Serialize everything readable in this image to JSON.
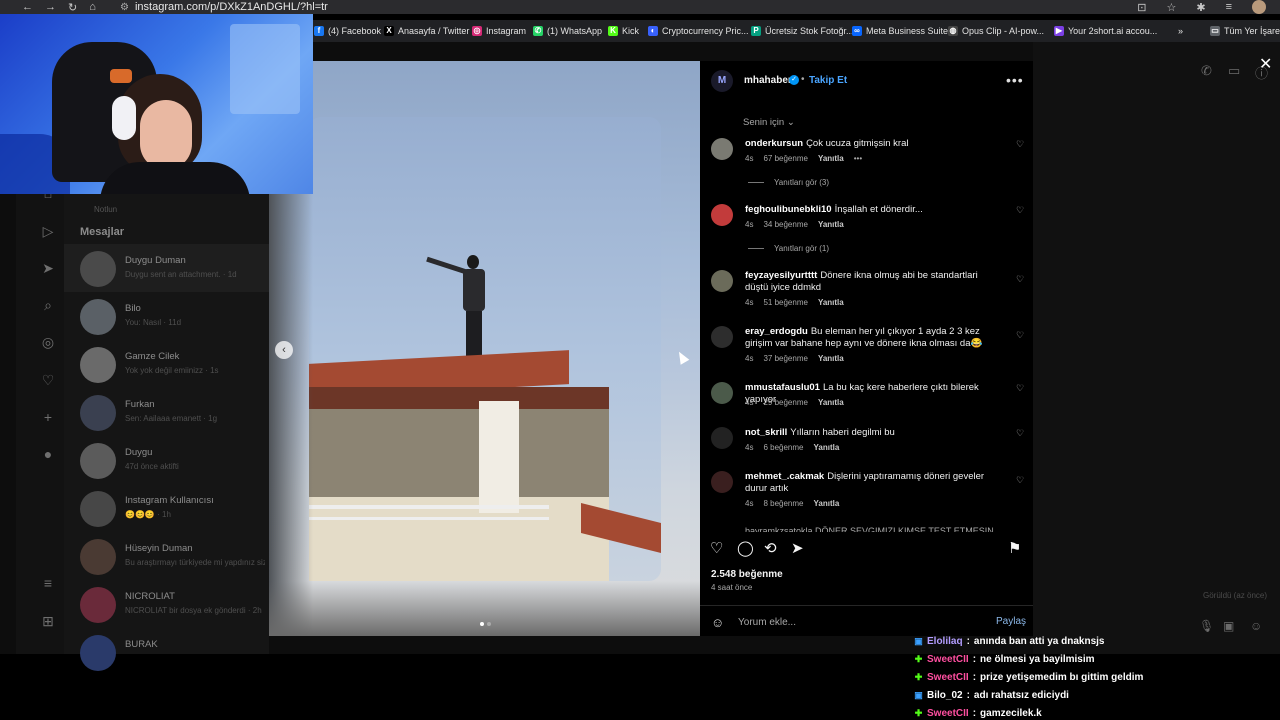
{
  "browser": {
    "url": "instagram.com/p/DXkZ1AnDGHL/?hl=tr"
  },
  "bookmarks": [
    {
      "label": "(4) Facebook",
      "icon": "facebook-icon",
      "color": "#1877f2",
      "glyph": "f"
    },
    {
      "label": "Anasayfa / Twitter",
      "icon": "x-icon",
      "color": "#000000",
      "glyph": "X"
    },
    {
      "label": "Instagram",
      "icon": "instagram-icon",
      "color": "#d62976",
      "glyph": "◎"
    },
    {
      "label": "(1) WhatsApp",
      "icon": "whatsapp-icon",
      "color": "#25d366",
      "glyph": "✆"
    },
    {
      "label": "Kick",
      "icon": "kick-icon",
      "color": "#53fc18",
      "glyph": "K"
    },
    {
      "label": "Cryptocurrency Pric...",
      "icon": "coinmarketcap-icon",
      "color": "#3861fb",
      "glyph": "◐"
    },
    {
      "label": "Ücretsiz Stok Fotoğr...",
      "icon": "pexels-icon",
      "color": "#05a081",
      "glyph": "P"
    },
    {
      "label": "Meta Business Suite",
      "icon": "meta-icon",
      "color": "#0866ff",
      "glyph": "∞"
    },
    {
      "label": "Opus Clip - AI-pow...",
      "icon": "opus-icon",
      "color": "#444444",
      "glyph": "◍"
    },
    {
      "label": "Your 2short.ai accou...",
      "icon": "2short-icon",
      "color": "#7b3fe4",
      "glyph": "▶"
    },
    {
      "label": "Tüm Yer İşaretle",
      "icon": "folder-icon",
      "color": "#5f6368",
      "glyph": "▭"
    }
  ],
  "sidebar": {
    "notifications_label": "Notlun",
    "messages_title": "Mesajlar",
    "conversations": [
      {
        "name": "Duygu Duman",
        "preview": "Duygu sent an attachment. · 1d"
      },
      {
        "name": "Bilo",
        "preview": "You: Nasıl · 11d"
      },
      {
        "name": "Gamze Cilek",
        "preview": "Yok yok değil emiinizz · 1s"
      },
      {
        "name": "Furkan",
        "preview": "Sen: Aailaaa emanett · 1g"
      },
      {
        "name": "Duygu",
        "preview": "47d önce aktifti"
      },
      {
        "name": "Instagram Kullanıcısı",
        "preview": "😊😊😊 · 1h"
      },
      {
        "name": "Hüseyin Duman",
        "preview": "Bu araştırmayı türkiyede mi yapdınız sizi"
      },
      {
        "name": "NICROLIAT",
        "preview": "NICROLIAT bir dosya ek gönderdi · 2h"
      },
      {
        "name": "BURAK",
        "preview": ""
      }
    ]
  },
  "post": {
    "author": "mhahaber",
    "follow_label": "Takip Et",
    "for_you_label": "Senin için",
    "likes": "2.548 beğenme",
    "time_ago": "4 saat önce",
    "comment_placeholder": "Yorum ekle...",
    "post_button": "Paylaş",
    "comments": [
      {
        "user": "onderkursun",
        "text": "Çok ucuza gitmişsin kral",
        "time": "4s",
        "likes": "67 beğenme",
        "reply": "Yanıtla",
        "more": "•••",
        "view_replies": "Yanıtları gör (3)"
      },
      {
        "user": "feghoulibunebkli10",
        "text": "İnşallah et dönerdir...",
        "time": "4s",
        "likes": "34 beğenme",
        "reply": "Yanıtla",
        "more": "",
        "view_replies": "Yanıtları gör (1)"
      },
      {
        "user": "feyzayesilyurtttt",
        "text": "Dönere ikna olmuş abi be standartlari düştü iyice ddmkd",
        "time": "4s",
        "likes": "51 beğenme",
        "reply": "Yanıtla",
        "more": "",
        "view_replies": ""
      },
      {
        "user": "eray_erdogdu",
        "text": "Bu eleman her yıl çıkıyor 1 ayda 2 3 kez girişim var bahane hep aynı ve dönere ikna olması da😂",
        "time": "4s",
        "likes": "37 beğenme",
        "reply": "Yanıtla",
        "more": "",
        "view_replies": ""
      },
      {
        "user": "mmustafauslu01",
        "text": "La bu kaç kere haberlere çıktı bilerek yapıyor",
        "time": "4s",
        "likes": "29 beğenme",
        "reply": "Yanıtla",
        "more": "",
        "view_replies": ""
      },
      {
        "user": "not_skrill",
        "text": "Yılların haberi degilmi bu",
        "time": "4s",
        "likes": "6 beğenme",
        "reply": "Yanıtla",
        "more": "",
        "view_replies": ""
      },
      {
        "user": "mehmet_.cakmak",
        "text": "Dişlerini yaptıramamış döneri geveler durur artık",
        "time": "4s",
        "likes": "8 beğenme",
        "reply": "Yanıtla",
        "more": "",
        "view_replies": ""
      }
    ],
    "partial_comment": "bayramkzsatokla DÖNER SEVGIMIZI KIMSE TEST ETMESIN"
  },
  "right_panel": {
    "seen_label": "Görüldü (az önce)"
  },
  "chat": [
    {
      "user": "Elolilaq",
      "message": "anında ban atti ya dnaknsjs",
      "badge": "▣",
      "badge_color": "#3aa0ff",
      "user_color": "#b39dff"
    },
    {
      "user": "SweetCII",
      "message": "ne ölmesi ya bayilmisim",
      "badge": "✚",
      "badge_color": "#53fc18",
      "user_color": "#ff4fa0"
    },
    {
      "user": "SweetCII",
      "message": "prize yetişemedim bı gittim geldim",
      "badge": "✚",
      "badge_color": "#53fc18",
      "user_color": "#ff4fa0"
    },
    {
      "user": "Bilo_02",
      "message": "adı rahatsız ediciydi",
      "badge": "▣",
      "badge_color": "#3aa0ff",
      "user_color": "#ffffff"
    },
    {
      "user": "SweetCII",
      "message": "gamzecilek.k",
      "badge": "✚",
      "badge_color": "#53fc18",
      "user_color": "#ff4fa0"
    }
  ]
}
